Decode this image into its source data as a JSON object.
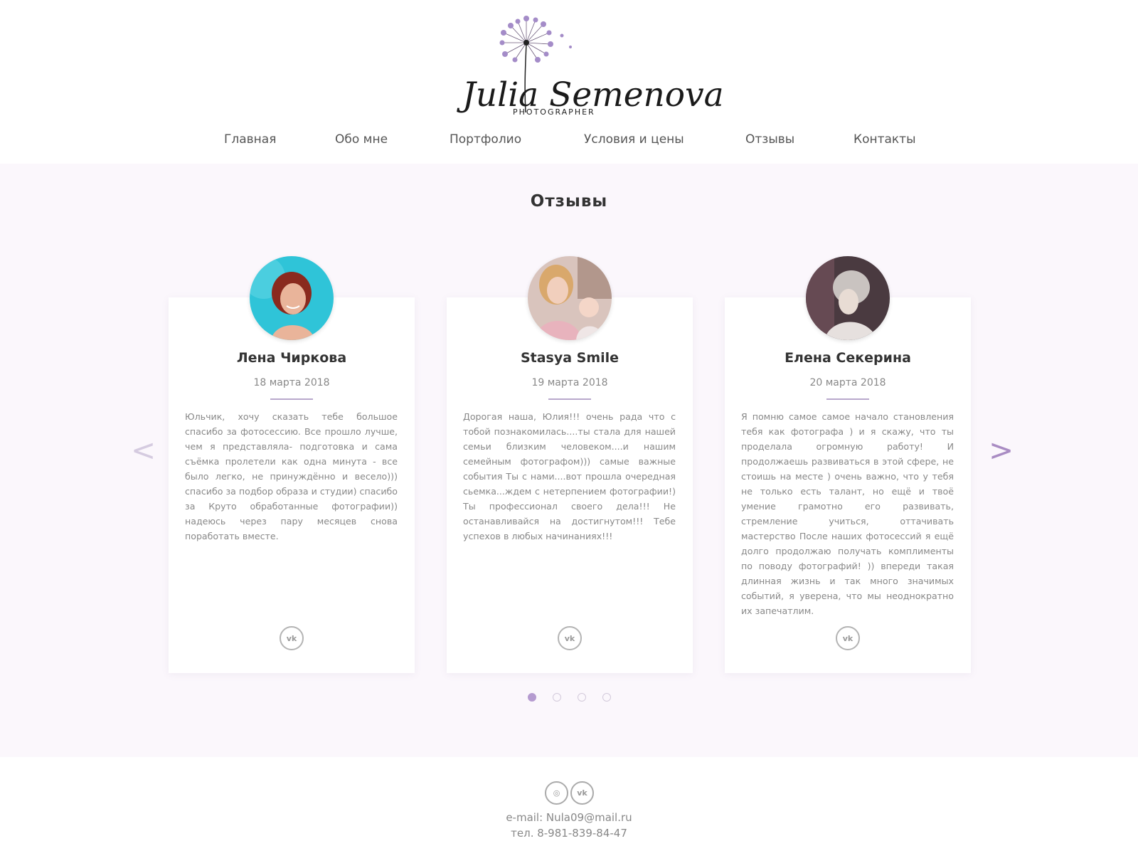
{
  "logo": {
    "name": "Julia Semenova",
    "subtitle": "PHOTOGRAPHER"
  },
  "nav": {
    "items": [
      "Главная",
      "Обо мне",
      "Портфолио",
      "Условия и цены",
      "Отзывы",
      "Контакты"
    ]
  },
  "reviews": {
    "title": "Отзывы",
    "prev_label": "<",
    "next_label": ">",
    "cards": [
      {
        "name": "Лена Чиркова",
        "date": "18 марта 2018",
        "text": "Юльчик, хочу сказать тебе большое спасибо за фотосессию. Все прошло лучше, чем я представляла- подготовка и сама съёмка пролетели как одна минута - все было легко, не принуждённо и весело))) спасибо за подбор образа и студии) спасибо за Круто обработанные фотографии)) надеюсь через пару месяцев снова поработать вместе.",
        "vk_label": "vk",
        "avatar_color": "#2fc4d8"
      },
      {
        "name": "Stasya Smile",
        "date": "19 марта 2018",
        "text": "Дорогая наша, Юлия!!! очень рада что с тобой познакомилась....ты стала для нашей семьи близким человеком....и нашим семейным фотографом))) самые важные события Ты с нами....вот прошла очередная сьемка...ждем с нетерпением фотографии!) Ты профессионал своего дела!!! Не останавливайся на достигнутом!!! Тебе успехов в любых начинаниях!!!",
        "vk_label": "vk",
        "avatar_color": "#d9b7b0"
      },
      {
        "name": "Елена Секерина",
        "date": "20 марта 2018",
        "text": "Я помню самое самое начало становления тебя как фотографа ) и я скажу, что ты проделала огромную работу! И продолжаешь развиваться в этой сфере, не стоишь на месте ) очень важно, что у тебя не только есть талант, но ещё и твоё умение грамотно его развивать, стремление учиться, оттачивать мастерство После наших фотосессий я ещё долго продолжаю получать комплименты по поводу фотографий! )) впереди такая длинная жизнь и так много значимых событий, я уверена, что мы неоднократно их запечатлим.",
        "vk_label": "vk",
        "avatar_color": "#4a3a40"
      }
    ],
    "pagination": {
      "total": 4,
      "active": 1
    }
  },
  "footer": {
    "instagram_label": "◎",
    "vk_label": "vk",
    "email": "e-mail: Nula09@mail.ru",
    "phone": "тел. 8-981-839-84-47"
  },
  "colors": {
    "accent": "#b59bd0",
    "section_bg": "#fbf7fc",
    "arrow_active": "#a98cc3",
    "arrow_inactive": "#d5cbe0"
  },
  "icons": {
    "logo": "dandelion-icon",
    "prev": "chevron-left-icon",
    "next": "chevron-right-icon",
    "social_vk": "vk-icon",
    "social_instagram": "instagram-icon"
  }
}
